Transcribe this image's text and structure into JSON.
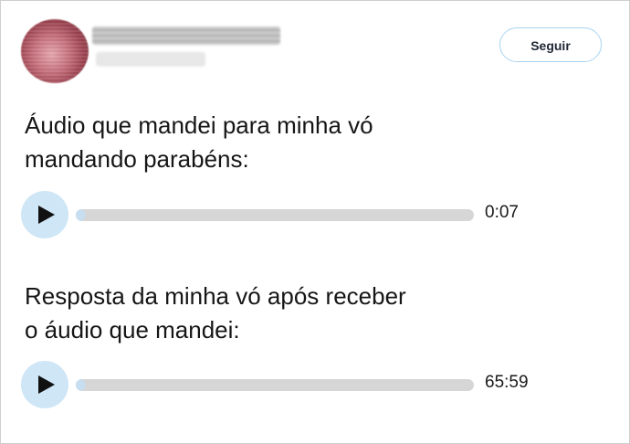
{
  "header": {
    "follow_label": "Seguir"
  },
  "posts": [
    {
      "text": "Áudio que mandei para minha vó\nmandando parabéns:",
      "audio": {
        "duration": "0:07",
        "progress": 0.0,
        "play_icon": "play-icon"
      }
    },
    {
      "text": "Resposta da minha vó após receber\no áudio que mandei:",
      "audio": {
        "duration": "65:59",
        "progress": 0.0,
        "play_icon": "play-icon"
      }
    }
  ],
  "colors": {
    "accent_light": "#cfe6f6",
    "follow_border": "#a9d4f1",
    "track": "#d6d6d6"
  }
}
